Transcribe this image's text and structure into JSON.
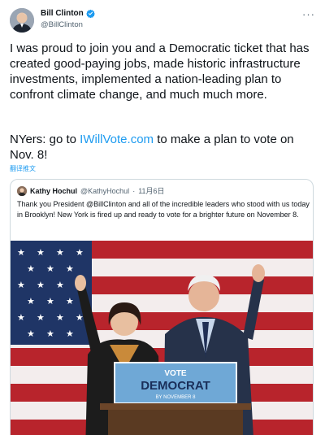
{
  "author": {
    "name": "Bill Clinton",
    "handle": "@BillClinton"
  },
  "tweet": {
    "text_part1": "I was proud to join you and a Democratic ticket that has created good-paying jobs, made historic infrastructure investments, implemented a nation-leading plan to confront climate change, and much much more.",
    "text_part2_prefix": "NYers: go to ",
    "link": "IWillVote.com",
    "text_part2_suffix": " to make a plan to vote on Nov. 8!",
    "translate_label": "翻译推文"
  },
  "quoted": {
    "name": "Kathy Hochul",
    "handle": "@KathyHochul",
    "separator": "·",
    "date": "11月6日",
    "text": "Thank you President @BillClinton and all of the incredible leaders who stood with us today in Brooklyn! New York is fired up and ready to vote for a brighter future on November 8.",
    "podium_line1": "VOTE",
    "podium_line2": "DEMOCRAT",
    "podium_line3": "BY NOVEMBER 8"
  },
  "colors": {
    "accent": "#1d9bf0",
    "verified": "#1d9bf0",
    "podium": "#6fa8d6"
  }
}
